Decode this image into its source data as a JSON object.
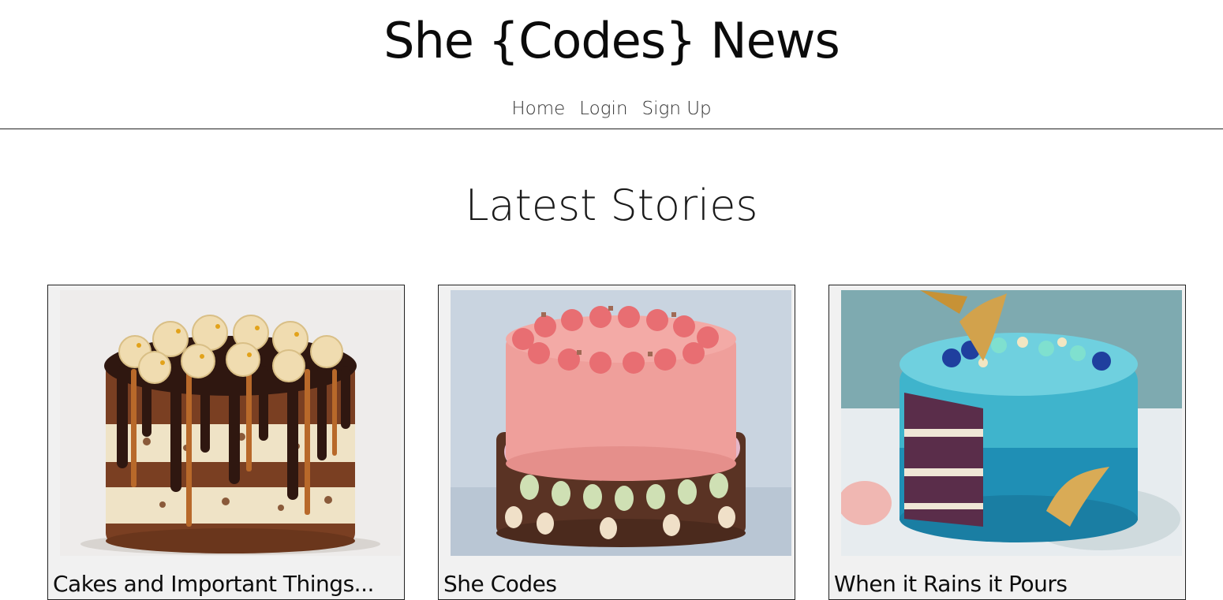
{
  "site": {
    "title": "She {Codes} News"
  },
  "nav": {
    "items": [
      {
        "label": "Home"
      },
      {
        "label": "Login"
      },
      {
        "label": "Sign Up"
      }
    ]
  },
  "main": {
    "heading": "Latest Stories",
    "stories": [
      {
        "title": "Cakes and Important Things...",
        "image": "chocolate-drip-cake"
      },
      {
        "title": "She Codes",
        "image": "pink-cake"
      },
      {
        "title": "When it Rains it Pours",
        "image": "mermaid-cake"
      }
    ]
  },
  "colors": {
    "border": "#222222",
    "card_background": "#f1f1f1",
    "text": "#111111"
  }
}
